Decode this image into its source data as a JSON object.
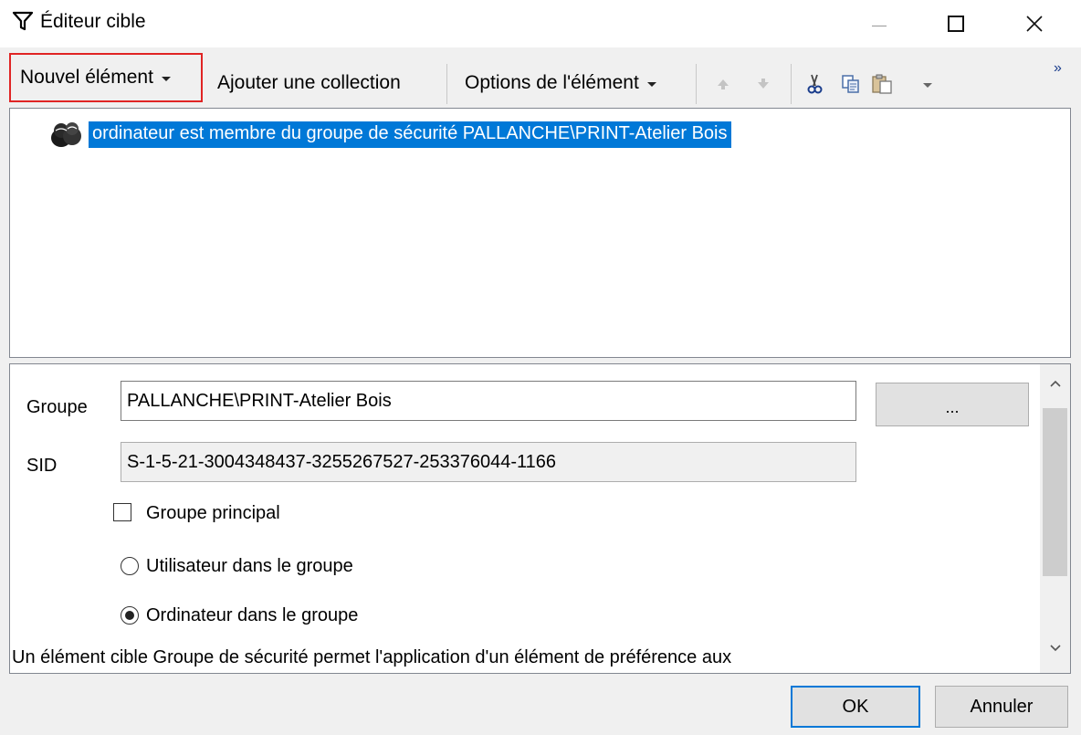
{
  "window": {
    "title": "Éditeur cible",
    "icon": "filter-icon"
  },
  "toolbar": {
    "new_item": "Nouvel élément",
    "add_collection": "Ajouter une collection",
    "item_options": "Options de l'élément",
    "icons": [
      "move-up-icon",
      "move-down-icon",
      "cut-icon",
      "copy-icon",
      "paste-icon"
    ],
    "overflow": "»"
  },
  "tree": {
    "items": [
      {
        "label": "ordinateur est membre du groupe de sécurité PALLANCHE\\PRINT-Atelier Bois",
        "icon": "security-group-icon",
        "selected": true
      }
    ]
  },
  "properties": {
    "group_label": "Groupe",
    "group_value": "PALLANCHE\\PRINT-Atelier Bois",
    "browse_label": "...",
    "sid_label": "SID",
    "sid_value": "S-1-5-21-3004348437-3255267527-253376044-1166",
    "primary_group_label": "Groupe principal",
    "primary_group_checked": false,
    "user_in_group_label": "Utilisateur dans le groupe",
    "computer_in_group_label": "Ordinateur dans le groupe",
    "selected_radio": "computer",
    "description": "Un élément cible Groupe de sécurité permet l'application d'un élément de préférence aux"
  },
  "buttons": {
    "ok": "OK",
    "cancel": "Annuler"
  },
  "colors": {
    "selection": "#0078d7",
    "highlight_border": "#e02424"
  }
}
